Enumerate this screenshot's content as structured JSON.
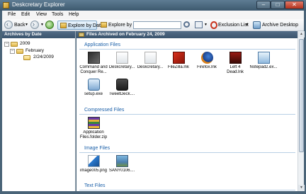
{
  "window": {
    "title": "Deskcretary Explorer"
  },
  "menu": [
    "File",
    "Edit",
    "View",
    "Tools",
    "Help"
  ],
  "toolbar": {
    "back_label": "Back",
    "explore_by_date_label": "Explore by Date",
    "explore_by_type_label": "Explore by Type",
    "search_value": "",
    "exclusion_list_label": "Exclusion List",
    "archive_desktop_label": "Archive Desktop"
  },
  "left_pane": {
    "header": "Archives by Date",
    "tree": [
      {
        "label": "2009",
        "expander": "−"
      },
      {
        "label": "February",
        "expander": "−"
      },
      {
        "label": "2/24/2009"
      }
    ]
  },
  "right_pane": {
    "header": "Files Archived on February 24, 2009",
    "groups": [
      {
        "title": "Application Files",
        "files": [
          {
            "label_line1": "Command and",
            "label_line2": "Conquer Re...",
            "icon": "game-shortcut-icon"
          },
          {
            "label_line1": "Deskcretary...",
            "label_line2": "",
            "icon": "deskcretary-icon"
          },
          {
            "label_line1": "Deskcretary...",
            "label_line2": "",
            "icon": "deskcretary-icon"
          },
          {
            "label_line1": "FileZilla.lnk",
            "label_line2": "",
            "icon": "filezilla-icon"
          },
          {
            "label_line1": "Firefox.lnk",
            "label_line2": "",
            "icon": "firefox-icon"
          },
          {
            "label_line1": "Left 4",
            "label_line2": "Dead.lnk",
            "icon": "left4dead-icon"
          },
          {
            "label_line1": "Notepad2.ex...",
            "label_line2": "",
            "icon": "notepad-icon"
          },
          {
            "label_line1": "setup.exe",
            "label_line2": "",
            "icon": "setup-icon"
          },
          {
            "label_line1": "TweetDeck....",
            "label_line2": "",
            "icon": "tweetdeck-icon"
          }
        ]
      },
      {
        "title": "Compressed Files",
        "files": [
          {
            "label_line1": "Application",
            "label_line2": "Files.folder.zip",
            "icon": "zip-archive-icon"
          }
        ]
      },
      {
        "title": "Image Files",
        "files": [
          {
            "label_line1": "image005.png",
            "label_line2": "",
            "icon": "png-image-icon"
          },
          {
            "label_line1": "SANY0106....",
            "label_line2": "",
            "icon": "photo-icon"
          }
        ]
      },
      {
        "title": "Text Files",
        "files": []
      }
    ]
  },
  "colors": {
    "accent": "#1a5fa8",
    "header": "#3b546d",
    "frame": "#4a6478"
  }
}
